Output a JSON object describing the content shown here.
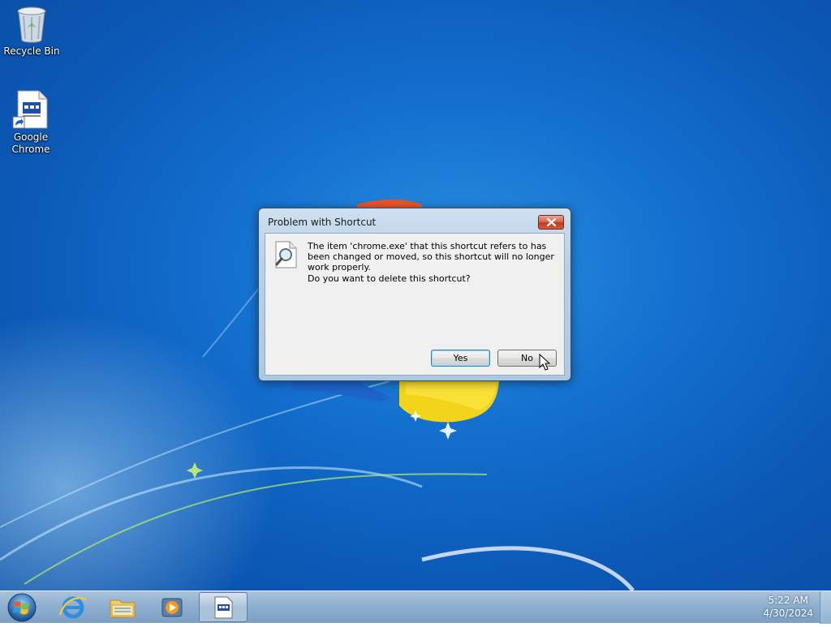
{
  "desktop": {
    "icons": [
      {
        "label": "Recycle Bin",
        "icon": "recycle-bin-icon"
      },
      {
        "label": "Google Chrome",
        "icon": "shortcut-file-icon"
      }
    ]
  },
  "dialog": {
    "title": "Problem with Shortcut",
    "message": "The item 'chrome.exe' that this shortcut refers to has been changed or moved, so this shortcut will no longer work properly.",
    "question": "Do you want to delete this shortcut?",
    "yes_label": "Yes",
    "no_label": "No",
    "icon": "magnifier-document-icon",
    "close_icon": "close-icon"
  },
  "taskbar": {
    "start_icon": "windows-start-orb-icon",
    "pinned": [
      "internet-explorer-icon",
      "file-explorer-icon",
      "media-player-icon",
      "shortcut-file-icon"
    ],
    "time": "5:22 AM",
    "date": "4/30/2024"
  },
  "colors": {
    "desktop_background": "#1470cf",
    "taskbar": "#8fb0cf",
    "close_button": "#c0391f"
  }
}
